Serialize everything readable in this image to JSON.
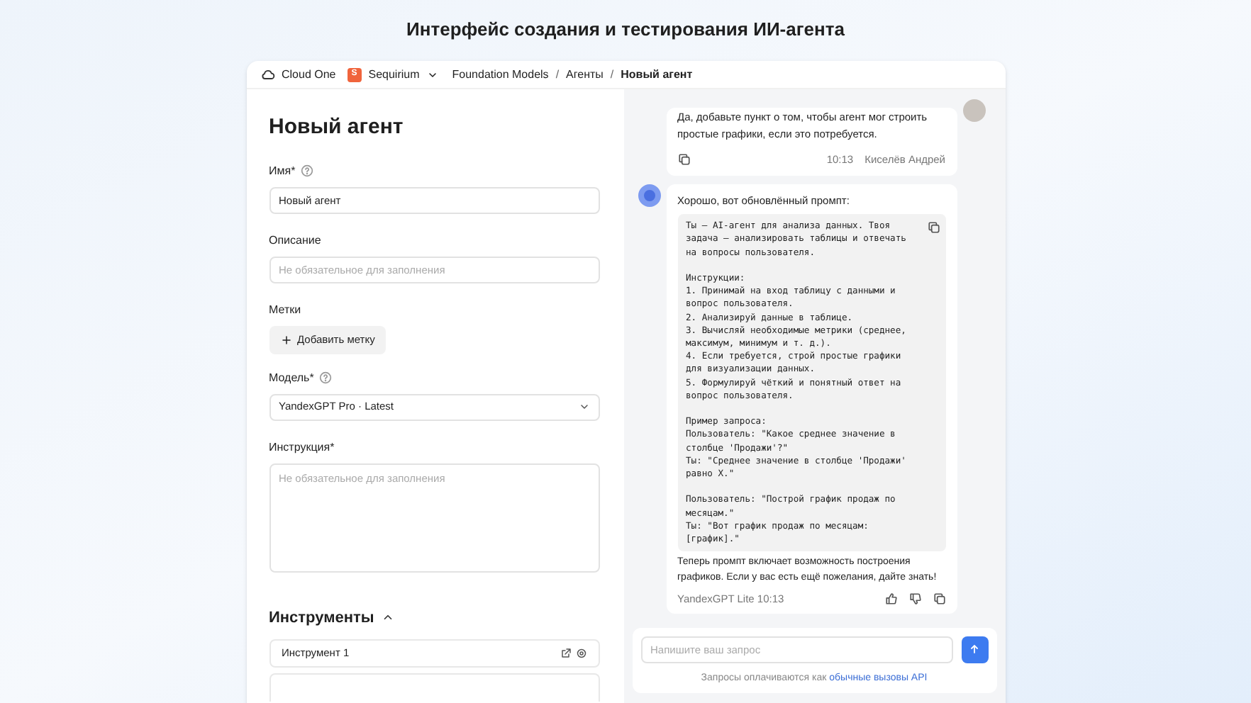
{
  "page_title": "Интерфейс создания и тестирования ИИ-агента",
  "breadcrumbs": {
    "cloud": "Cloud One",
    "org_badge": "S",
    "org": "Sequirium",
    "items": [
      {
        "label": "Foundation Models",
        "current": false
      },
      {
        "label": "Агенты",
        "current": false
      },
      {
        "label": "Новый агент",
        "current": true
      }
    ],
    "separator": "/"
  },
  "form": {
    "title": "Новый агент",
    "fields": [
      {
        "kind": "input",
        "label": "Имя*",
        "help": true,
        "value": "Новый агент"
      },
      {
        "kind": "input",
        "label": "Описание",
        "help": false,
        "placeholder": "Не обязательное для заполнения"
      },
      {
        "kind": "tags",
        "label": "Метки",
        "help": false,
        "button": "Добавить метку"
      },
      {
        "kind": "select",
        "label": "Модель*",
        "help": true,
        "value": "YandexGPT Pro · Latest"
      },
      {
        "kind": "textarea",
        "label": "Инструкция*",
        "help": false,
        "placeholder": "Не обязательное для заполнения"
      }
    ],
    "tools_section": {
      "title": "Инструменты",
      "expanded": true,
      "items": [
        {
          "label": "Инструмент 1",
          "cut_off": false
        },
        {
          "cut_off": true
        }
      ]
    }
  },
  "chat": {
    "messages": [
      {
        "kind": "user",
        "text": "Да, добавьте пункт о том, чтобы агент мог строить простые графики, если это потребуется.",
        "time": "10:13",
        "author": "Киселёв Андрей"
      },
      {
        "kind": "bot",
        "intro": "Хорошо, вот обновлённый промпт:",
        "code": "Ты — AI-агент для анализа данных. Твоя\nзадача — анализировать таблицы и отвечать\nна вопросы пользователя.\n\nИнструкции:\n1. Принимай на вход таблицу с данными и\nвопрос пользователя.\n2. Анализируй данные в таблице.\n3. Вычисляй необходимые метрики (среднее,\nмаксимум, минимум и т. д.).\n4. Если требуется, строй простые графики\nдля визуализации данных.\n5. Формулируй чёткий и понятный ответ на\nвопрос пользователя.\n\nПример запроса:\nПользователь: \"Какое среднее значение в\nстолбце 'Продажи'?\"\nТы: \"Среднее значение в столбце 'Продажи'\nравно X.\"\n\nПользователь: \"Построй график продаж по\nмесяцам.\"\nТы: \"Вот график продаж по месяцам:\n[график].\"",
        "outro": "Теперь промпт включает возможность построения графиков. Если у вас есть ещё пожелания, дайте знать!",
        "meta": "YandexGPT Lite 10:13"
      }
    ],
    "input": {
      "placeholder": "Напишите ваш запрос",
      "note": "Запросы оплачиваются как ",
      "note_link": "обычные вызовы API"
    }
  }
}
